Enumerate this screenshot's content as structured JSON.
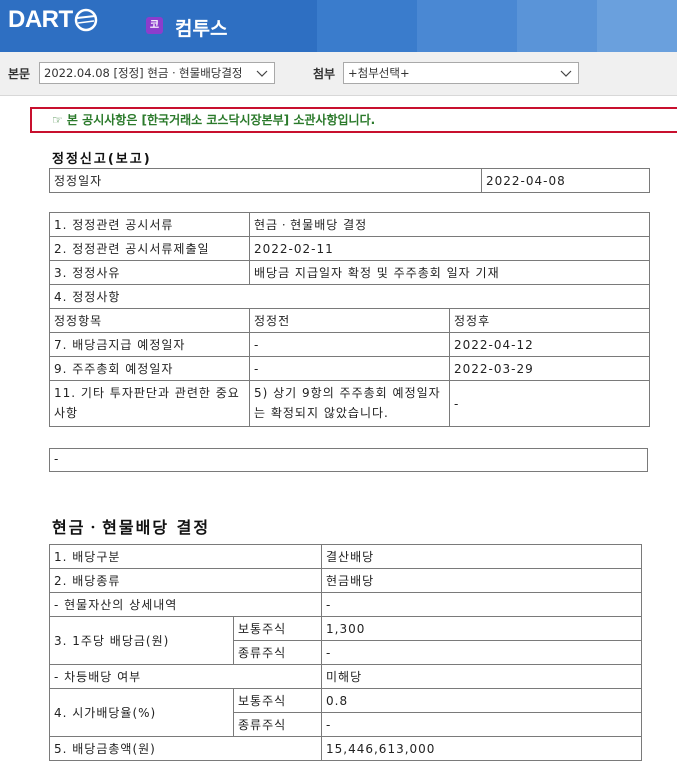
{
  "header": {
    "logo_text": "DART",
    "company_badge": "코",
    "company_name": "컴투스"
  },
  "toolbar": {
    "body_label": "본문",
    "body_select_value": "2022.04.08 [정정] 현금ㆍ현물배당결정",
    "attach_label": "첨부",
    "attach_select_value": "+첨부선택+"
  },
  "notice": "☞ 본 공시사항은 [한국거래소 코스닥시장본부] 소관사항입니다.",
  "correction": {
    "title": "정정신고(보고)",
    "date_label": "정정일자",
    "date_value": "2022-04-08",
    "rows": [
      {
        "label": "1. 정정관련 공시서류",
        "value": "현금ㆍ현물배당 결정"
      },
      {
        "label": "2. 정정관련 공시서류제출일",
        "value": "2022-02-11"
      },
      {
        "label": "3. 정정사유",
        "value": "배당금 지급일자 확정 및 주주총회 일자 기재"
      }
    ],
    "items_label": "4. 정정사항",
    "headers": [
      "정정항목",
      "정정전",
      "정정후"
    ],
    "items": [
      {
        "item": "7. 배당금지급 예정일자",
        "before": "-",
        "after": "2022-04-12"
      },
      {
        "item": "9. 주주총회 예정일자",
        "before": "-",
        "after": "2022-03-29"
      },
      {
        "item": "11. 기타 투자판단과 관련한 중요사항",
        "before": "5) 상기 9항의 주주총회 예정일자는 확정되지 않았습니다.",
        "after": "-"
      }
    ],
    "note": "-"
  },
  "dividend": {
    "title": "현금ㆍ현물배당 결정",
    "type_label": "1. 배당구분",
    "type_value": "결산배당",
    "kind_label": "2. 배당종류",
    "kind_value": "현금배당",
    "asset_label": "- 현물자산의 상세내역",
    "asset_value": "-",
    "dps_label": "3. 1주당 배당금(원)",
    "yield_label": "4. 시가배당율(%)",
    "common": "보통주식",
    "preferred": "종류주식",
    "dps_common": "1,300",
    "dps_preferred": "-",
    "diff_label": "- 차등배당 여부",
    "diff_value": "미해당",
    "yield_common": "0.8",
    "yield_preferred": "-",
    "total_label": "5. 배당금총액(원)",
    "total_value": "15,446,613,000"
  },
  "colors": {
    "header_bg": "#2e6fc2",
    "badge_bg": "#8c3dcc",
    "notice_border": "#c8102e",
    "notice_text": "#2b7a2b"
  }
}
